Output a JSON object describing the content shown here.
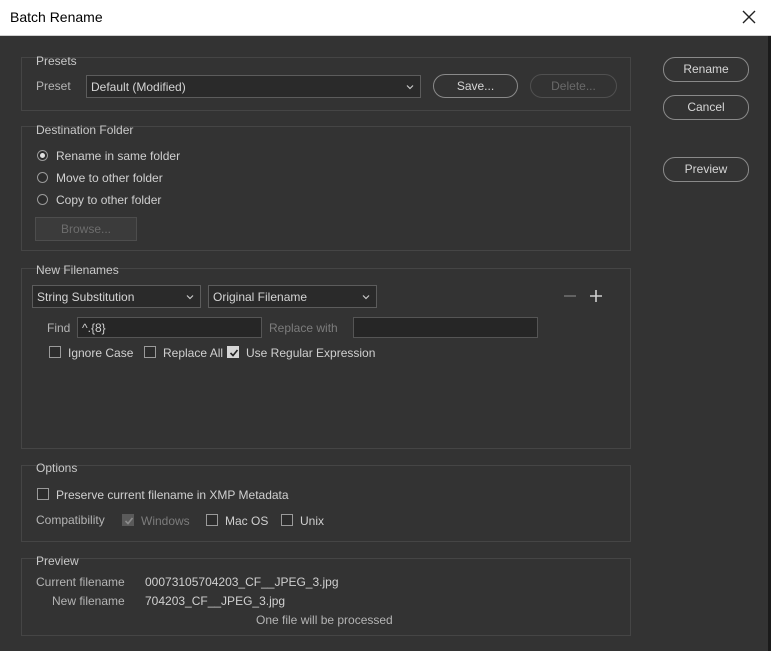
{
  "window": {
    "title": "Batch Rename"
  },
  "actions": {
    "rename": "Rename",
    "cancel": "Cancel",
    "preview": "Preview"
  },
  "presets": {
    "group_title": "Presets",
    "preset_label": "Preset",
    "preset_value": "Default (Modified)",
    "save": "Save...",
    "delete": "Delete..."
  },
  "destination": {
    "group_title": "Destination Folder",
    "options": [
      "Rename in same folder",
      "Move to other folder",
      "Copy to other folder"
    ],
    "selected_index": 0,
    "browse": "Browse..."
  },
  "new_filenames": {
    "group_title": "New Filenames",
    "type_value": "String Substitution",
    "source_value": "Original Filename",
    "minus_icon": "minus-icon",
    "plus_icon": "plus-icon",
    "find_label": "Find",
    "find_value": "^.{8}",
    "replace_label": "Replace with",
    "replace_value": "",
    "ignore_case": {
      "label": "Ignore Case",
      "checked": false
    },
    "replace_all": {
      "label": "Replace All",
      "checked": false
    },
    "use_regex": {
      "label": "Use Regular Expression",
      "checked": true
    }
  },
  "options": {
    "group_title": "Options",
    "preserve_xmp": {
      "label": "Preserve current filename in XMP Metadata",
      "checked": false
    },
    "compat_label": "Compatibility",
    "windows": {
      "label": "Windows",
      "checked": true,
      "disabled": true
    },
    "macos": {
      "label": "Mac OS",
      "checked": false
    },
    "unix": {
      "label": "Unix",
      "checked": false
    }
  },
  "preview": {
    "group_title": "Preview",
    "current_label": "Current filename",
    "current_value": "00073105704203_CF__JPEG_3.jpg",
    "new_label": "New filename",
    "new_value": "704203_CF__JPEG_3.jpg",
    "summary": "One file will be processed"
  },
  "colors": {
    "background": "#333333",
    "titlebar": "#ffffff",
    "group_border": "#454545"
  }
}
